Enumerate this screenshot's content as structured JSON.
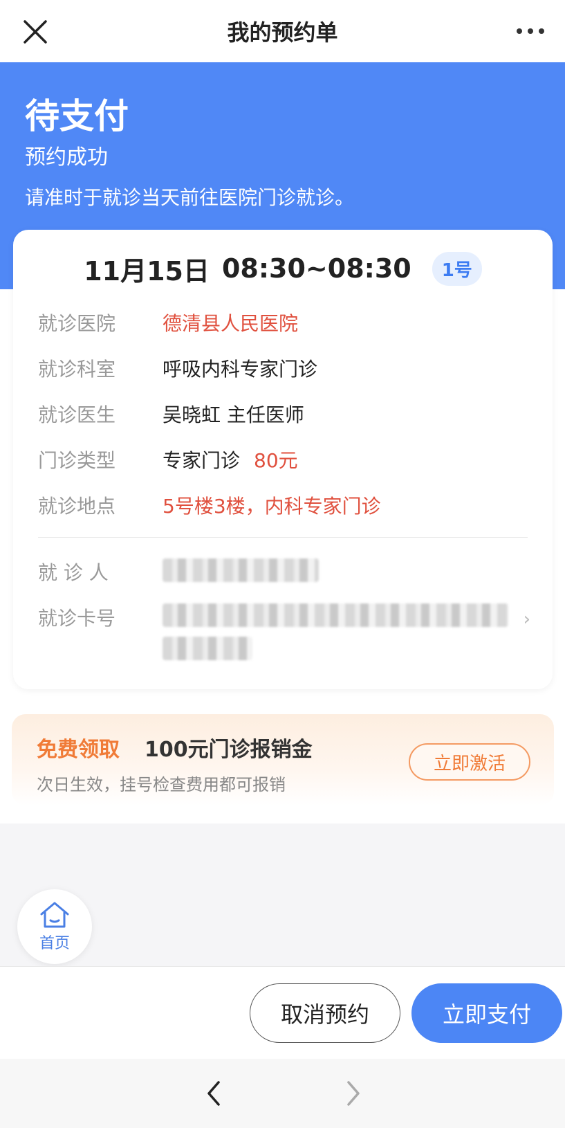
{
  "navbar": {
    "title": "我的预约单",
    "close_icon": "close-icon",
    "more_icon": "more-icon"
  },
  "hero": {
    "status": "待支付",
    "subtitle": "预约成功",
    "tip": "请准时于就诊当天前往医院门诊就诊。"
  },
  "appointment": {
    "date": "11月15日",
    "time_range": "08:30~08:30",
    "number": "1号",
    "rows": [
      {
        "label": "就诊医院",
        "value": "德清县人民医院"
      },
      {
        "label": "就诊科室",
        "value": "呼吸内科专家门诊"
      },
      {
        "label": "就诊医生",
        "value": "吴晓虹  主任医师"
      },
      {
        "label": "门诊类型",
        "value": "专家门诊",
        "fee": "80元"
      },
      {
        "label": "就诊地点",
        "value": "5号楼3楼，内科专家门诊"
      }
    ],
    "patient_label": "就 诊 人",
    "card_label": "就诊卡号"
  },
  "promo": {
    "free": "免费领取",
    "amount": "100元门诊报销金",
    "desc": "次日生效，挂号检查费用都可报销",
    "button": "立即激活"
  },
  "home": {
    "label": "首页",
    "icon": "home-icon"
  },
  "actions": {
    "cancel": "取消预约",
    "pay": "立即支付"
  },
  "colors": {
    "accent_blue": "#5088f6",
    "alert_red": "#e0503e",
    "promo_orange": "#f07b37"
  }
}
